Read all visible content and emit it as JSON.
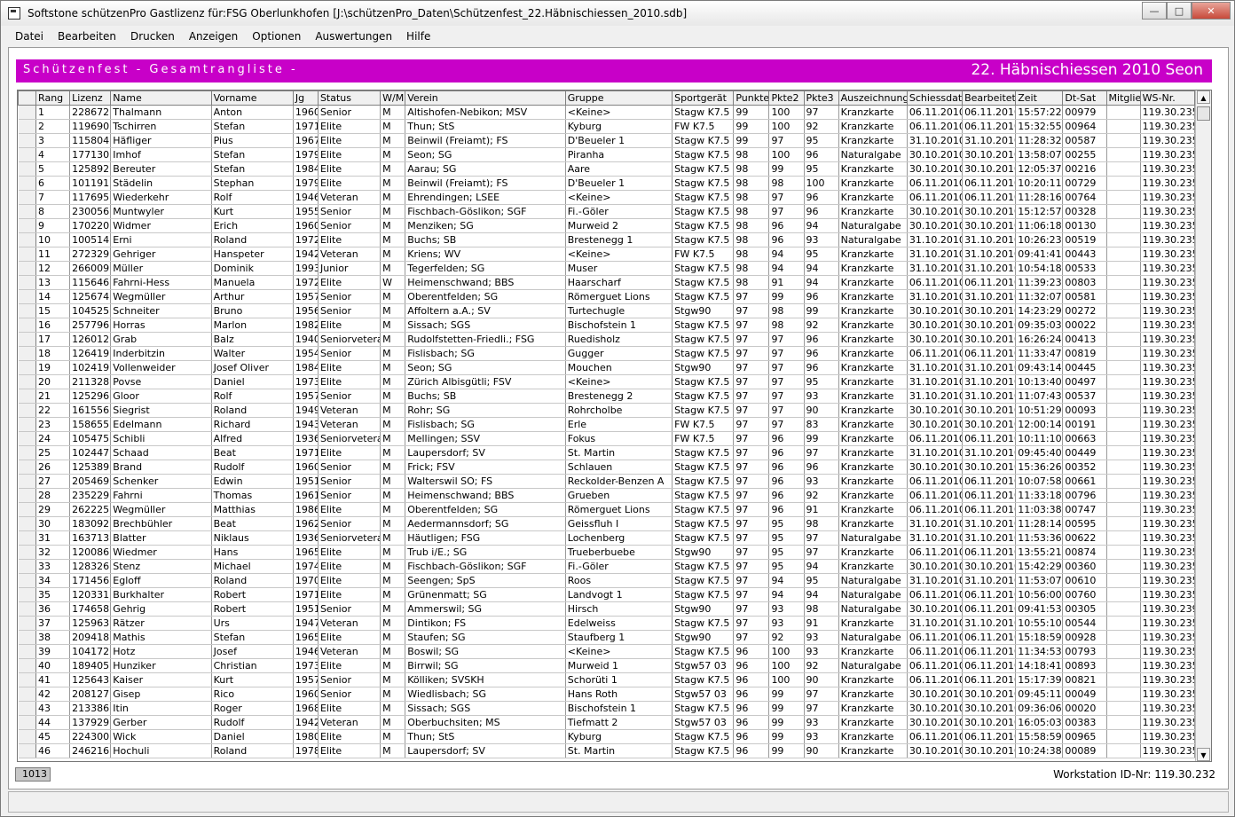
{
  "window": {
    "title": "Softstone  schützenPro  Gastlizenz für:FSG Oberlunkhofen   [J:\\schützenPro_Daten\\Schützenfest_22.Häbnischiessen_2010.sdb]",
    "minimize": "—",
    "maximize": "□",
    "close": "✕"
  },
  "menu": [
    "Datei",
    "Bearbeiten",
    "Drucken",
    "Anzeigen",
    "Optionen",
    "Auswertungen",
    "Hilfe"
  ],
  "banner": {
    "left": "Schützenfest - Gesamtrangliste -",
    "right": "22. Häbnischiessen 2010 Seon"
  },
  "columns": [
    "Rang",
    "Lizenz",
    "Name",
    "Vorname",
    "Jg",
    "Status",
    "W/M",
    "Verein",
    "Gruppe",
    "Sportgerät",
    "Punkte",
    "Pkte2",
    "Pkte3",
    "Auszeichnung",
    "Schiessdat.",
    "Bearbeitet",
    "Zeit",
    "Dt-Sat",
    "Mitglie",
    "WS-Nr."
  ],
  "rows": [
    [
      "1",
      "228672",
      "Thalmann",
      "Anton",
      "1960",
      "Senior",
      "M",
      "Altishofen-Nebikon; MSV",
      "<Keine>",
      "Stagw K7.5",
      "99",
      "100",
      "97",
      "Kranzkarte",
      "06.11.2010",
      "06.11.2010",
      "15:57:22",
      "00979",
      "",
      "119.30.235"
    ],
    [
      "2",
      "119690",
      "Tschirren",
      "Stefan",
      "1971",
      "Elite",
      "M",
      "Thun; StS",
      "Kyburg",
      "FW K7.5",
      "99",
      "100",
      "92",
      "Kranzkarte",
      "06.11.2010",
      "06.11.2010",
      "15:32:55",
      "00964",
      "",
      "119.30.235"
    ],
    [
      "3",
      "115804",
      "Häfliger",
      "Pius",
      "1967",
      "Elite",
      "M",
      "Beinwil (Freiamt); FS",
      "D'Beueler 1",
      "Stagw K7.5",
      "99",
      "97",
      "95",
      "Kranzkarte",
      "31.10.2010",
      "31.10.2010",
      "11:28:32",
      "00587",
      "",
      "119.30.235"
    ],
    [
      "4",
      "177130",
      "Imhof",
      "Stefan",
      "1979",
      "Elite",
      "M",
      "Seon; SG",
      "Piranha",
      "Stagw K7.5",
      "98",
      "100",
      "96",
      "Naturalgabe",
      "30.10.2010",
      "30.10.2010",
      "13:58:07",
      "00255",
      "",
      "119.30.235"
    ],
    [
      "5",
      "125892",
      "Bereuter",
      "Stefan",
      "1984",
      "Elite",
      "M",
      "Aarau; SG",
      "Aare",
      "Stagw K7.5",
      "98",
      "99",
      "95",
      "Kranzkarte",
      "30.10.2010",
      "30.10.2010",
      "12:05:37",
      "00216",
      "",
      "119.30.235"
    ],
    [
      "6",
      "101191",
      "Städelin",
      "Stephan",
      "1979",
      "Elite",
      "M",
      "Beinwil (Freiamt); FS",
      "D'Beueler 1",
      "Stagw K7.5",
      "98",
      "98",
      "100",
      "Kranzkarte",
      "06.11.2010",
      "06.11.2010",
      "10:20:11",
      "00729",
      "",
      "119.30.235"
    ],
    [
      "7",
      "117695",
      "Wiederkehr",
      "Rolf",
      "1946",
      "Veteran",
      "M",
      "Ehrendingen; LSEE",
      "<Keine>",
      "Stagw K7.5",
      "98",
      "97",
      "96",
      "Kranzkarte",
      "06.11.2010",
      "06.11.2010",
      "11:28:16",
      "00764",
      "",
      "119.30.235"
    ],
    [
      "8",
      "230056",
      "Muntwyler",
      "Kurt",
      "1955",
      "Senior",
      "M",
      "Fischbach-Göslikon; SGF",
      "Fi.-Göler",
      "Stagw K7.5",
      "98",
      "97",
      "96",
      "Kranzkarte",
      "30.10.2010",
      "30.10.2010",
      "15:12:57",
      "00328",
      "",
      "119.30.235"
    ],
    [
      "9",
      "170220",
      "Widmer",
      "Erich",
      "1960",
      "Senior",
      "M",
      "Menziken; SG",
      "Murweid 2",
      "Stagw K7.5",
      "98",
      "96",
      "94",
      "Naturalgabe",
      "30.10.2010",
      "30.10.2010",
      "11:06:18",
      "00130",
      "",
      "119.30.235"
    ],
    [
      "10",
      "100514",
      "Erni",
      "Roland",
      "1972",
      "Elite",
      "M",
      "Buchs; SB",
      "Brestenegg 1",
      "Stagw K7.5",
      "98",
      "96",
      "93",
      "Naturalgabe",
      "31.10.2010",
      "31.10.2010",
      "10:26:23",
      "00519",
      "",
      "119.30.235"
    ],
    [
      "11",
      "272329",
      "Gehriger",
      "Hanspeter",
      "1942",
      "Veteran",
      "M",
      "Kriens; WV",
      "<Keine>",
      "FW K7.5",
      "98",
      "94",
      "95",
      "Kranzkarte",
      "31.10.2010",
      "31.10.2010",
      "09:41:41",
      "00443",
      "",
      "119.30.235"
    ],
    [
      "12",
      "266009",
      "Müller",
      "Dominik",
      "1993",
      "Junior",
      "M",
      "Tegerfelden; SG",
      "Muser",
      "Stagw K7.5",
      "98",
      "94",
      "94",
      "Kranzkarte",
      "31.10.2010",
      "31.10.2010",
      "10:54:18",
      "00533",
      "",
      "119.30.235"
    ],
    [
      "13",
      "115646",
      "Fahrni-Hess",
      "Manuela",
      "1972",
      "Elite",
      "W",
      "Heimenschwand; BBS",
      "Haarscharf",
      "Stagw K7.5",
      "98",
      "91",
      "94",
      "Kranzkarte",
      "06.11.2010",
      "06.11.2010",
      "11:39:23",
      "00803",
      "",
      "119.30.235"
    ],
    [
      "14",
      "125674",
      "Wegmüller",
      "Arthur",
      "1957",
      "Senior",
      "M",
      "Oberentfelden; SG",
      "Römerguet Lions",
      "Stagw K7.5",
      "97",
      "99",
      "96",
      "Kranzkarte",
      "31.10.2010",
      "31.10.2010",
      "11:32:07",
      "00581",
      "",
      "119.30.235"
    ],
    [
      "15",
      "104525",
      "Schneiter",
      "Bruno",
      "1956",
      "Senior",
      "M",
      "Affoltern a.A.; SV",
      "Turtechugle",
      "Stgw90",
      "97",
      "98",
      "99",
      "Kranzkarte",
      "30.10.2010",
      "30.10.2010",
      "14:23:29",
      "00272",
      "",
      "119.30.235"
    ],
    [
      "16",
      "257796",
      "Horras",
      "Marlon",
      "1982",
      "Elite",
      "M",
      "Sissach; SGS",
      "Bischofstein 1",
      "Stagw K7.5",
      "97",
      "98",
      "92",
      "Kranzkarte",
      "30.10.2010",
      "30.10.2010",
      "09:35:03",
      "00022",
      "",
      "119.30.235"
    ],
    [
      "17",
      "126012",
      "Grab",
      "Balz",
      "1940",
      "Seniorveteran",
      "M",
      "Rudolfstetten-Friedli.; FSG",
      "Ruedisholz",
      "Stagw K7.5",
      "97",
      "97",
      "96",
      "Kranzkarte",
      "30.10.2010",
      "30.10.2010",
      "16:26:24",
      "00413",
      "",
      "119.30.235"
    ],
    [
      "18",
      "126419",
      "Inderbitzin",
      "Walter",
      "1954",
      "Senior",
      "M",
      "Fislisbach; SG",
      "Gugger",
      "Stagw K7.5",
      "97",
      "97",
      "96",
      "Kranzkarte",
      "06.11.2010",
      "06.11.2010",
      "11:33:47",
      "00819",
      "",
      "119.30.235"
    ],
    [
      "19",
      "102419",
      "Vollenweider",
      "Josef Oliver",
      "1984",
      "Elite",
      "M",
      "Seon; SG",
      "Mouchen",
      "Stgw90",
      "97",
      "97",
      "96",
      "Kranzkarte",
      "31.10.2010",
      "31.10.2010",
      "09:43:14",
      "00445",
      "",
      "119.30.235"
    ],
    [
      "20",
      "211328",
      "Povse",
      "Daniel",
      "1973",
      "Elite",
      "M",
      "Zürich Albisgütli; FSV",
      "<Keine>",
      "Stagw K7.5",
      "97",
      "97",
      "95",
      "Kranzkarte",
      "31.10.2010",
      "31.10.2010",
      "10:13:40",
      "00497",
      "",
      "119.30.235"
    ],
    [
      "21",
      "125296",
      "Gloor",
      "Rolf",
      "1957",
      "Senior",
      "M",
      "Buchs; SB",
      "Brestenegg 2",
      "Stagw K7.5",
      "97",
      "97",
      "93",
      "Kranzkarte",
      "31.10.2010",
      "31.10.2010",
      "11:07:43",
      "00537",
      "",
      "119.30.235"
    ],
    [
      "22",
      "161556",
      "Siegrist",
      "Roland",
      "1949",
      "Veteran",
      "M",
      "Rohr; SG",
      "Rohrcholbe",
      "Stagw K7.5",
      "97",
      "97",
      "90",
      "Kranzkarte",
      "30.10.2010",
      "30.10.2010",
      "10:51:29",
      "00093",
      "",
      "119.30.235"
    ],
    [
      "23",
      "158655",
      "Edelmann",
      "Richard",
      "1943",
      "Veteran",
      "M",
      "Fislisbach; SG",
      "Erle",
      "FW K7.5",
      "97",
      "97",
      "83",
      "Kranzkarte",
      "30.10.2010",
      "30.10.2010",
      "12:00:14",
      "00191",
      "",
      "119.30.235"
    ],
    [
      "24",
      "105475",
      "Schibli",
      "Alfred",
      "1936",
      "Seniorveteran",
      "M",
      "Mellingen; SSV",
      "Fokus",
      "FW K7.5",
      "97",
      "96",
      "99",
      "Kranzkarte",
      "06.11.2010",
      "06.11.2010",
      "10:11:10",
      "00663",
      "",
      "119.30.235"
    ],
    [
      "25",
      "102447",
      "Schaad",
      "Beat",
      "1971",
      "Elite",
      "M",
      "Laupersdorf; SV",
      "St. Martin",
      "Stagw K7.5",
      "97",
      "96",
      "97",
      "Kranzkarte",
      "31.10.2010",
      "31.10.2010",
      "09:45:40",
      "00449",
      "",
      "119.30.235"
    ],
    [
      "26",
      "125389",
      "Brand",
      "Rudolf",
      "1960",
      "Senior",
      "M",
      "Frick; FSV",
      "Schlauen",
      "Stagw K7.5",
      "97",
      "96",
      "96",
      "Kranzkarte",
      "30.10.2010",
      "30.10.2010",
      "15:36:26",
      "00352",
      "",
      "119.30.235"
    ],
    [
      "27",
      "205469",
      "Schenker",
      "Edwin",
      "1951",
      "Senior",
      "M",
      "Walterswil SO; FS",
      "Reckolder-Benzen A",
      "Stagw K7.5",
      "97",
      "96",
      "93",
      "Kranzkarte",
      "06.11.2010",
      "06.11.2010",
      "10:07:58",
      "00661",
      "",
      "119.30.235"
    ],
    [
      "28",
      "235229",
      "Fahrni",
      "Thomas",
      "1961",
      "Senior",
      "M",
      "Heimenschwand; BBS",
      "Grueben",
      "Stagw K7.5",
      "97",
      "96",
      "92",
      "Kranzkarte",
      "06.11.2010",
      "06.11.2010",
      "11:33:18",
      "00796",
      "",
      "119.30.235"
    ],
    [
      "29",
      "262225",
      "Wegmüller",
      "Matthias",
      "1986",
      "Elite",
      "M",
      "Oberentfelden; SG",
      "Römerguet Lions",
      "Stagw K7.5",
      "97",
      "96",
      "91",
      "Kranzkarte",
      "06.11.2010",
      "06.11.2010",
      "11:03:38",
      "00747",
      "",
      "119.30.235"
    ],
    [
      "30",
      "183092",
      "Brechbühler",
      "Beat",
      "1962",
      "Senior",
      "M",
      "Aedermannsdorf; SG",
      "Geissfluh I",
      "Stagw K7.5",
      "97",
      "95",
      "98",
      "Kranzkarte",
      "31.10.2010",
      "31.10.2010",
      "11:28:14",
      "00595",
      "",
      "119.30.235"
    ],
    [
      "31",
      "163713",
      "Blatter",
      "Niklaus",
      "1936",
      "Seniorveteran",
      "M",
      "Häutligen; FSG",
      "Lochenberg",
      "Stagw K7.5",
      "97",
      "95",
      "97",
      "Naturalgabe",
      "31.10.2010",
      "31.10.2010",
      "11:53:36",
      "00622",
      "",
      "119.30.235"
    ],
    [
      "32",
      "120086",
      "Wiedmer",
      "Hans",
      "1965",
      "Elite",
      "M",
      "Trub i/E.; SG",
      "Trueberbuebe",
      "Stgw90",
      "97",
      "95",
      "97",
      "Kranzkarte",
      "06.11.2010",
      "06.11.2010",
      "13:55:21",
      "00874",
      "",
      "119.30.235"
    ],
    [
      "33",
      "128326",
      "Stenz",
      "Michael",
      "1974",
      "Elite",
      "M",
      "Fischbach-Göslikon; SGF",
      "Fi.-Göler",
      "Stagw K7.5",
      "97",
      "95",
      "94",
      "Kranzkarte",
      "30.10.2010",
      "30.10.2010",
      "15:42:29",
      "00360",
      "",
      "119.30.235"
    ],
    [
      "34",
      "171456",
      "Egloff",
      "Roland",
      "1970",
      "Elite",
      "M",
      "Seengen; SpS",
      "Roos",
      "Stagw K7.5",
      "97",
      "94",
      "95",
      "Naturalgabe",
      "31.10.2010",
      "31.10.2010",
      "11:53:07",
      "00610",
      "",
      "119.30.235"
    ],
    [
      "35",
      "120331",
      "Burkhalter",
      "Robert",
      "1971",
      "Elite",
      "M",
      "Grünenmatt; SG",
      "Landvogt 1",
      "Stagw K7.5",
      "97",
      "94",
      "94",
      "Naturalgabe",
      "06.11.2010",
      "06.11.2010",
      "10:56:00",
      "00760",
      "",
      "119.30.235"
    ],
    [
      "36",
      "174658",
      "Gehrig",
      "Robert",
      "1951",
      "Senior",
      "M",
      "Ammerswil; SG",
      "Hirsch",
      "Stgw90",
      "97",
      "93",
      "98",
      "Naturalgabe",
      "30.10.2010",
      "06.11.2010",
      "09:41:53",
      "00305",
      "",
      "119.30.239"
    ],
    [
      "37",
      "125963",
      "Rätzer",
      "Urs",
      "1947",
      "Veteran",
      "M",
      "Dintikon; FS",
      "Edelweiss",
      "Stagw K7.5",
      "97",
      "93",
      "91",
      "Kranzkarte",
      "31.10.2010",
      "31.10.2010",
      "10:55:10",
      "00544",
      "",
      "119.30.235"
    ],
    [
      "38",
      "209418",
      "Mathis",
      "Stefan",
      "1965",
      "Elite",
      "M",
      "Staufen; SG",
      "Staufberg 1",
      "Stgw90",
      "97",
      "92",
      "93",
      "Naturalgabe",
      "06.11.2010",
      "06.11.2010",
      "15:18:59",
      "00928",
      "",
      "119.30.235"
    ],
    [
      "39",
      "104172",
      "Hotz",
      "Josef",
      "1946",
      "Veteran",
      "M",
      "Boswil; SG",
      "<Keine>",
      "Stagw K7.5",
      "96",
      "100",
      "93",
      "Kranzkarte",
      "06.11.2010",
      "06.11.2010",
      "11:34:53",
      "00793",
      "",
      "119.30.235"
    ],
    [
      "40",
      "189405",
      "Hunziker",
      "Christian",
      "1973",
      "Elite",
      "M",
      "Birrwil; SG",
      "Murweid 1",
      "Stgw57 03",
      "96",
      "100",
      "92",
      "Naturalgabe",
      "06.11.2010",
      "06.11.2010",
      "14:18:41",
      "00893",
      "",
      "119.30.235"
    ],
    [
      "41",
      "125643",
      "Kaiser",
      "Kurt",
      "1957",
      "Senior",
      "M",
      "Kölliken; SVSKH",
      "Schorüti 1",
      "Stagw K7.5",
      "96",
      "100",
      "90",
      "Kranzkarte",
      "06.11.2010",
      "06.11.2010",
      "15:17:39",
      "00821",
      "",
      "119.30.235"
    ],
    [
      "42",
      "208127",
      "Gisep",
      "Rico",
      "1960",
      "Senior",
      "M",
      "Wiedlisbach; SG",
      "Hans Roth",
      "Stgw57 03",
      "96",
      "99",
      "97",
      "Kranzkarte",
      "30.10.2010",
      "30.10.2010",
      "09:45:11",
      "00049",
      "",
      "119.30.235"
    ],
    [
      "43",
      "213386",
      "Itin",
      "Roger",
      "1968",
      "Elite",
      "M",
      "Sissach; SGS",
      "Bischofstein 1",
      "Stagw K7.5",
      "96",
      "99",
      "97",
      "Kranzkarte",
      "30.10.2010",
      "30.10.2010",
      "09:36:06",
      "00020",
      "",
      "119.30.235"
    ],
    [
      "44",
      "137929",
      "Gerber",
      "Rudolf",
      "1942",
      "Veteran",
      "M",
      "Oberbuchsiten; MS",
      "Tiefmatt 2",
      "Stgw57 03",
      "96",
      "99",
      "93",
      "Kranzkarte",
      "30.10.2010",
      "30.10.2010",
      "16:05:03",
      "00383",
      "",
      "119.30.235"
    ],
    [
      "45",
      "224300",
      "Wick",
      "Daniel",
      "1980",
      "Elite",
      "M",
      "Thun; StS",
      "Kyburg",
      "Stagw K7.5",
      "96",
      "99",
      "93",
      "Kranzkarte",
      "06.11.2010",
      "06.11.2010",
      "15:58:59",
      "00965",
      "",
      "119.30.235"
    ],
    [
      "46",
      "246216",
      "Hochuli",
      "Roland",
      "1978",
      "Elite",
      "M",
      "Laupersdorf; SV",
      "St. Martin",
      "Stagw K7.5",
      "96",
      "99",
      "90",
      "Kranzkarte",
      "30.10.2010",
      "30.10.2010",
      "10:24:38",
      "00089",
      "",
      "119.30.235"
    ]
  ],
  "footer": {
    "record_count": "1013",
    "workstation": "Workstation ID-Nr: 119.30.232"
  },
  "colors": {
    "banner": "#c800c8",
    "banner_text": "#ffffff"
  }
}
